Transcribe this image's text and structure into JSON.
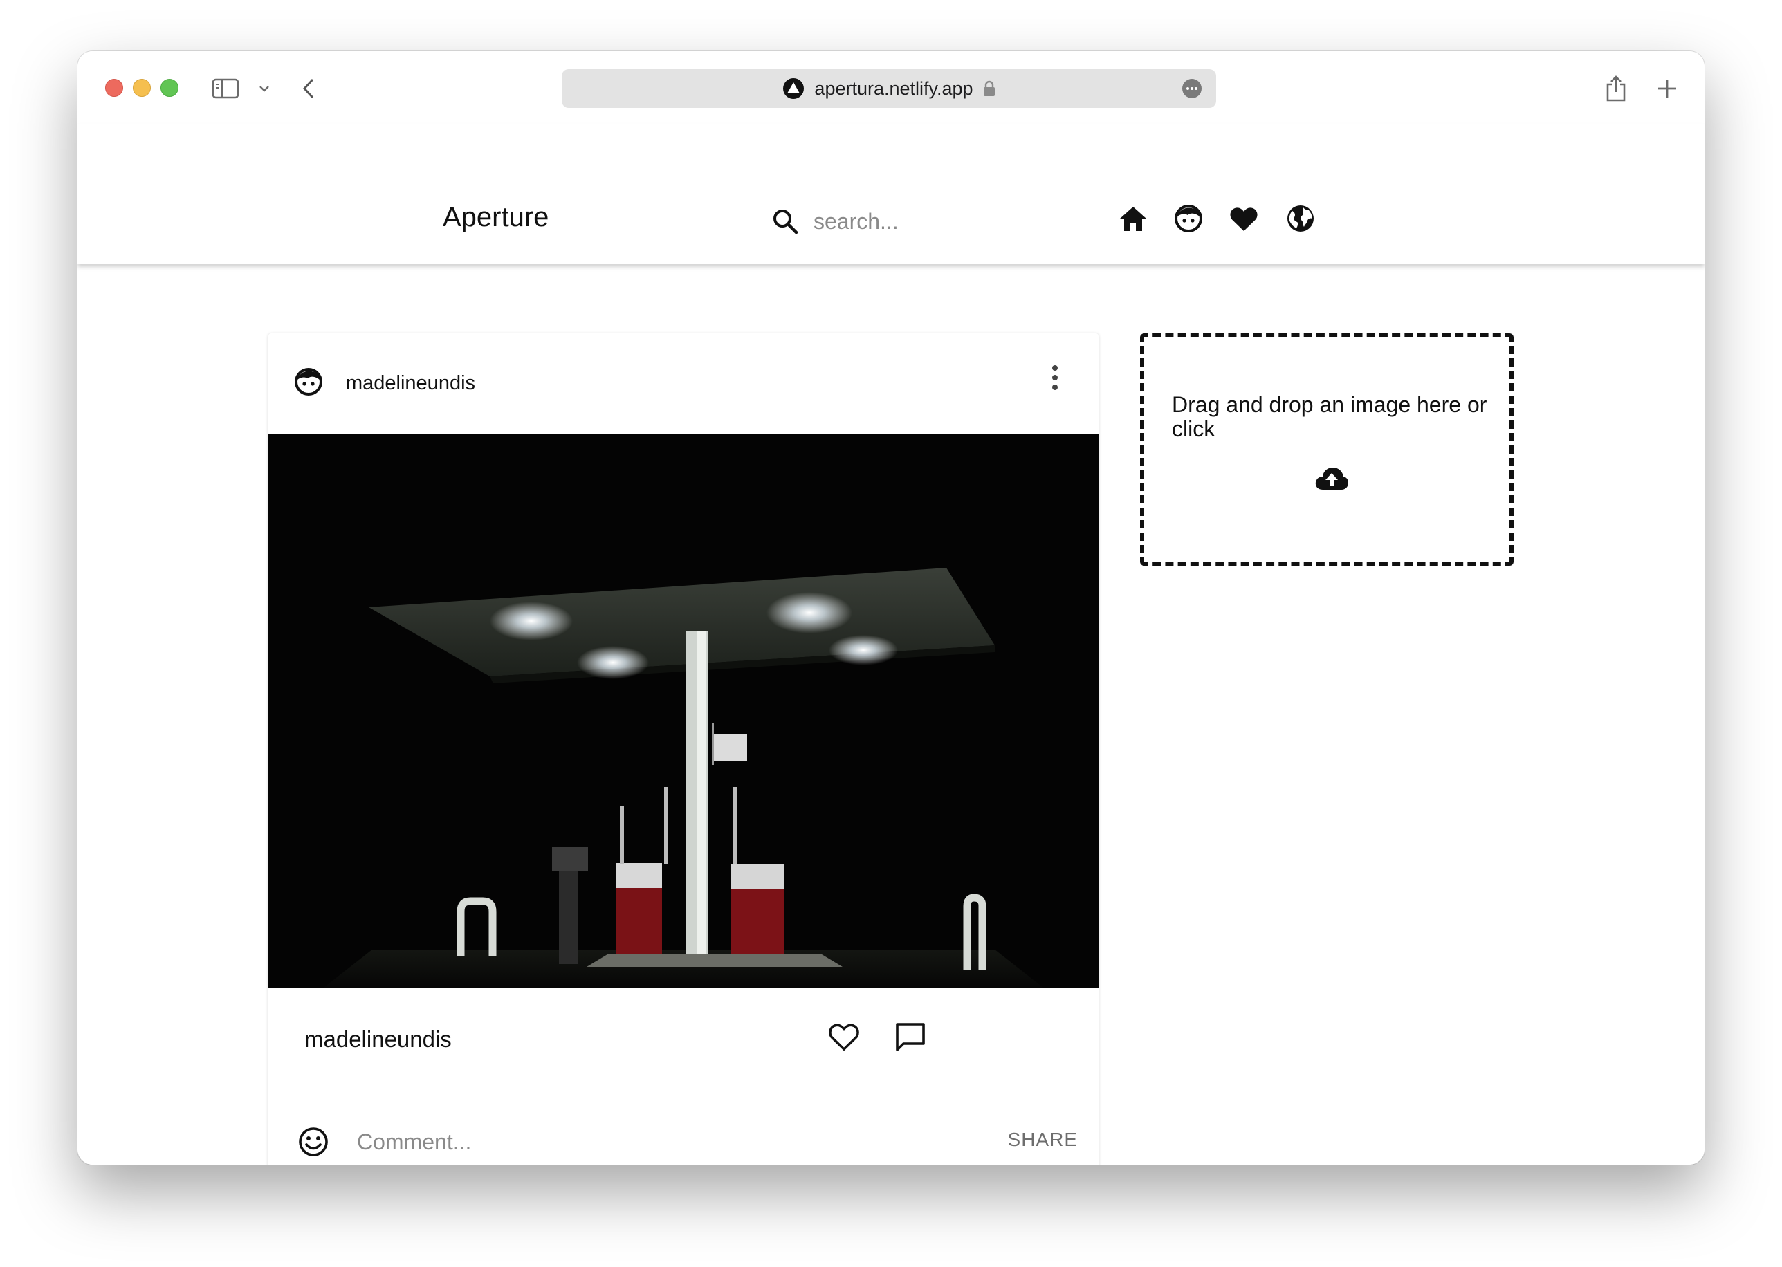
{
  "browser": {
    "url": "apertura.netlify.app"
  },
  "app": {
    "brand": "Aperture",
    "search": {
      "placeholder": "search..."
    },
    "nav": [
      "home-icon",
      "profile-icon",
      "heart-icon",
      "globe-icon"
    ]
  },
  "post": {
    "username": "madelineundis",
    "footer_username": "madelineundis",
    "image_alt": "Gas station at night",
    "comment_placeholder": "Comment...",
    "share_label": "SHARE"
  },
  "upload": {
    "prompt": "Drag and drop an image here or click",
    "icon": "cloud-upload-icon"
  },
  "colors": {
    "accent": "#111111",
    "muted_text": "#8a8a8a",
    "share_text": "#6e6e6e"
  }
}
